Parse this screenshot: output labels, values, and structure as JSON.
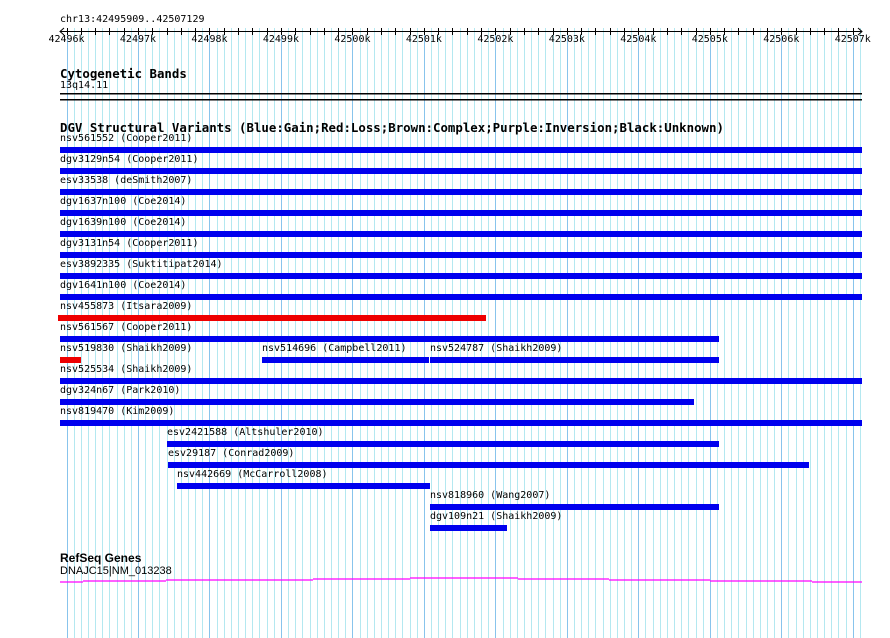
{
  "location": "chr13:42495909..42507129",
  "view": {
    "start": 42495909,
    "end": 42507129
  },
  "ruler": {
    "tick_labels": [
      "42496k",
      "42497k",
      "42498k",
      "42499k",
      "42500k",
      "42501k",
      "42502k",
      "42503k",
      "42504k",
      "42505k",
      "42506k",
      "42507k"
    ]
  },
  "cytoband": {
    "title": "Cytogenetic Bands",
    "band": "13q14.11"
  },
  "dgv": {
    "title": "DGV Structural Variants (Blue:Gain;Red:Loss;Brown:Complex;Purple:Inversion;Black:Unknown)",
    "colors": {
      "gain": "#0000ee",
      "loss": "#ee0000"
    },
    "rows": [
      [
        {
          "label": "nsv561552 (Cooper2011)",
          "type": "gain",
          "start": 42495909,
          "end": 42507129
        }
      ],
      [
        {
          "label": "dgv3129n54 (Cooper2011)",
          "type": "gain",
          "start": 42495909,
          "end": 42507129
        }
      ],
      [
        {
          "label": "esv33538 (deSmith2007)",
          "type": "gain",
          "start": 42495909,
          "end": 42507129
        }
      ],
      [
        {
          "label": "dgv1637n100 (Coe2014)",
          "type": "gain",
          "start": 42495909,
          "end": 42507129
        }
      ],
      [
        {
          "label": "dgv1639n100 (Coe2014)",
          "type": "gain",
          "start": 42495909,
          "end": 42507129
        }
      ],
      [
        {
          "label": "dgv3131n54 (Cooper2011)",
          "type": "gain",
          "start": 42495909,
          "end": 42507129
        }
      ],
      [
        {
          "label": "esv3892335 (Suktitipat2014)",
          "type": "gain",
          "start": 42495909,
          "end": 42507129
        }
      ],
      [
        {
          "label": "dgv1641n100 (Coe2014)",
          "type": "gain",
          "start": 42495909,
          "end": 42507129
        }
      ],
      [
        {
          "label": "nsv455873 (Itsara2009)",
          "type": "loss",
          "start": 42495880,
          "end": 42501869
        }
      ],
      [
        {
          "label": "nsv561567 (Cooper2011)",
          "type": "gain",
          "start": 42495909,
          "end": 42505128
        }
      ],
      [
        {
          "label": "nsv519830 (Shaikh2009)",
          "type": "loss",
          "start": 42495909,
          "end": 42496203
        },
        {
          "label": "nsv514696 (Campbell2011)",
          "type": "gain",
          "start": 42498735,
          "end": 42501071
        },
        {
          "label": "nsv524787 (Shaikh2009)",
          "type": "gain",
          "start": 42501085,
          "end": 42505128
        }
      ],
      [
        {
          "label": "nsv525534 (Shaikh2009)",
          "type": "gain",
          "start": 42495909,
          "end": 42507129
        }
      ],
      [
        {
          "label": "dgv324n67 (Park2010)",
          "type": "gain",
          "start": 42495909,
          "end": 42504779
        }
      ],
      [
        {
          "label": "nsv819470 (Kim2009)",
          "type": "gain",
          "start": 42495909,
          "end": 42507129
        }
      ],
      [
        {
          "label": "esv2421588 (Altshuler2010)",
          "type": "gain",
          "start": 42497406,
          "end": 42505128
        }
      ],
      [
        {
          "label": "esv29187 (Conrad2009)",
          "type": "gain",
          "start": 42497420,
          "end": 42506388
        }
      ],
      [
        {
          "label": "nsv442669 (McCarroll2008)",
          "type": "gain",
          "start": 42497546,
          "end": 42501085
        }
      ],
      [
        {
          "label": "nsv818960 (Wang2007)",
          "type": "gain",
          "start": 42501085,
          "end": 42505128
        }
      ],
      [
        {
          "label": "dgv109n21 (Shaikh2009)",
          "type": "gain",
          "start": 42501085,
          "end": 42502163
        }
      ]
    ]
  },
  "refseq": {
    "title": "RefSeq Genes",
    "gene_label": "DNAJC15|NM_013238",
    "color": "#ff00ff"
  }
}
